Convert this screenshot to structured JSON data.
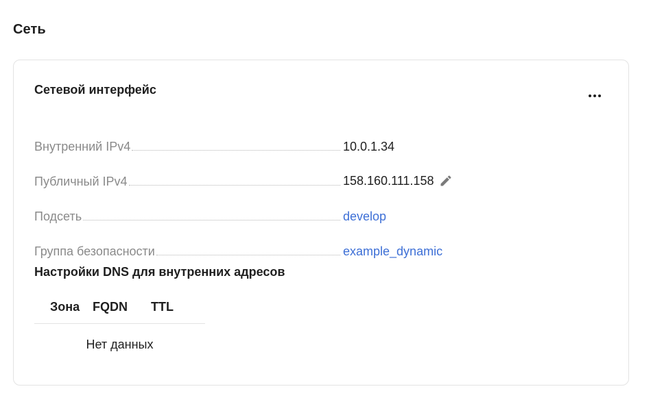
{
  "section": {
    "title": "Сеть"
  },
  "card": {
    "title": "Сетевой интерфейс",
    "more_icon": "more-horizontal-icon",
    "rows": [
      {
        "label": "Внутренний IPv4",
        "value": "10.0.1.34",
        "link": false
      },
      {
        "label": "Публичный IPv4",
        "value": "158.160.111.158",
        "link": false,
        "icon": "pencil-icon"
      },
      {
        "label": "Подсеть",
        "value": "develop",
        "link": true
      },
      {
        "label": "Группа безопасности",
        "value": "example_dynamic",
        "link": true
      }
    ]
  },
  "dns": {
    "title": "Настройки DNS для внутренних адресов",
    "columns": [
      "Зона",
      "FQDN",
      "TTL"
    ],
    "empty_text": "Нет данных"
  },
  "colors": {
    "link": "#3d6fd6",
    "label": "#8a8a8a",
    "text": "#1f1f1f",
    "border": "#e3e3e3"
  }
}
